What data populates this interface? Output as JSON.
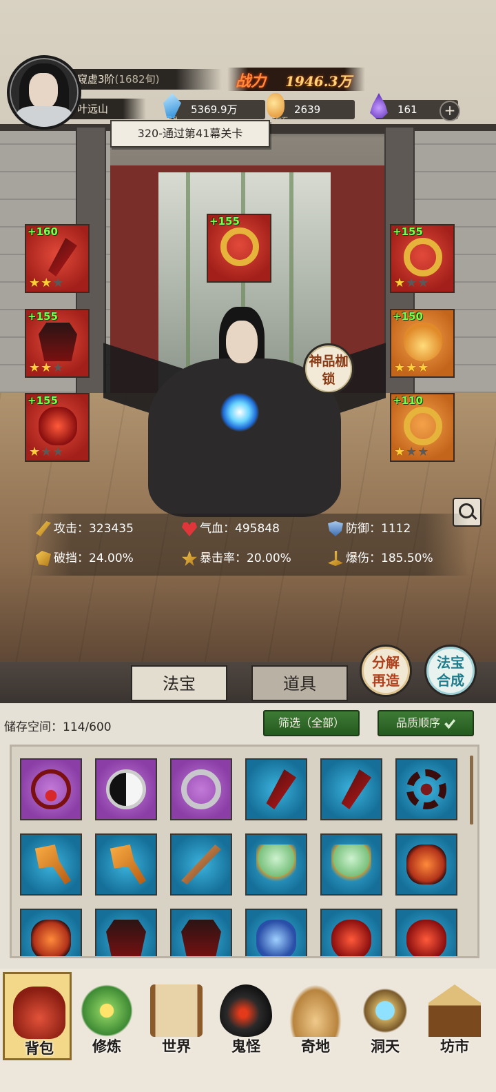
{
  "header": {
    "realm": "窥虚3阶",
    "realm_sub": "(1682旬)",
    "player_name": "叶远山",
    "power_label": "战力",
    "power_value": "1946.3万",
    "resources": [
      {
        "icon": "spirit-crystal-icon",
        "caption": "灵晶",
        "value": "5369.9万"
      },
      {
        "icon": "creation-stone-icon",
        "caption": "造化石",
        "value": "2639"
      },
      {
        "icon": "soul-flame-icon",
        "caption": "",
        "value": "161"
      }
    ],
    "plus_label": "+",
    "quest": "320-通过第41幕关卡"
  },
  "equipment": {
    "slots": [
      {
        "pos": "left-1",
        "level": "+160",
        "quality": "red",
        "stars": 2,
        "icon": "dagger-icon"
      },
      {
        "pos": "left-2",
        "level": "+155",
        "quality": "red",
        "stars": 2,
        "icon": "armor-icon"
      },
      {
        "pos": "left-3",
        "level": "+155",
        "quality": "red",
        "stars": 1,
        "icon": "helmet-icon"
      },
      {
        "pos": "top",
        "level": "+155",
        "quality": "red",
        "stars": 0,
        "icon": "cloud-talisman-icon"
      },
      {
        "pos": "right-1",
        "level": "+155",
        "quality": "red",
        "stars": 1,
        "icon": "crown-icon"
      },
      {
        "pos": "right-2",
        "level": "+150",
        "quality": "orange",
        "stars": 3,
        "icon": "pendant-icon"
      },
      {
        "pos": "right-3",
        "level": "+110",
        "quality": "orange",
        "stars": 1,
        "icon": "ring-icon"
      }
    ],
    "divine_lock": "神品枷锁"
  },
  "stats": [
    {
      "icon": "attack-icon",
      "label": "攻击：",
      "value": "323435"
    },
    {
      "icon": "hp-heart-icon",
      "label": "气血：",
      "value": "495848"
    },
    {
      "icon": "defense-shield-icon",
      "label": "防御：",
      "value": "1112"
    },
    {
      "icon": "break-block-icon",
      "label": "破挡：",
      "value": "24.00%"
    },
    {
      "icon": "crit-rate-icon",
      "label": "暴击率：",
      "value": "20.00%"
    },
    {
      "icon": "crit-damage-icon",
      "label": "爆伤：",
      "value": "185.50%"
    }
  ],
  "tabs": {
    "fabao": "法宝",
    "daoju": "道具",
    "active": "fabao"
  },
  "round_buttons": {
    "decompose": "分解再造",
    "synthesize": "法宝合成"
  },
  "inventory": {
    "storage_label": "储存空间：",
    "storage_value": "114/600",
    "filter_label": "筛选（全部）",
    "sort_label": "品质顺序",
    "items": [
      {
        "quality": "purple",
        "icon": "necklace-icon"
      },
      {
        "quality": "purple",
        "icon": "yin-yang-ring-icon"
      },
      {
        "quality": "purple",
        "icon": "jade-ring-icon"
      },
      {
        "quality": "blue",
        "icon": "dagger-icon"
      },
      {
        "quality": "blue",
        "icon": "dagger-icon"
      },
      {
        "quality": "blue",
        "icon": "wheel-icon"
      },
      {
        "quality": "blue",
        "icon": "axe-icon"
      },
      {
        "quality": "blue",
        "icon": "axe-icon"
      },
      {
        "quality": "blue",
        "icon": "staff-icon"
      },
      {
        "quality": "blue",
        "icon": "jade-mirror-icon"
      },
      {
        "quality": "blue",
        "icon": "jade-mirror-icon"
      },
      {
        "quality": "blue",
        "icon": "golden-beast-icon"
      },
      {
        "quality": "blue",
        "icon": "golden-beast-icon"
      },
      {
        "quality": "blue",
        "icon": "armor-icon"
      },
      {
        "quality": "blue",
        "icon": "armor-icon"
      },
      {
        "quality": "blue",
        "icon": "blue-beast-icon"
      },
      {
        "quality": "blue",
        "icon": "demon-mask-icon"
      },
      {
        "quality": "blue",
        "icon": "demon-mask-icon"
      }
    ]
  },
  "nav": [
    {
      "id": "bag",
      "label": "背包",
      "icon": "bag-icon",
      "active": true
    },
    {
      "id": "cultivate",
      "label": "修炼",
      "icon": "lotus-icon",
      "active": false
    },
    {
      "id": "world",
      "label": "世界",
      "icon": "scroll-map-icon",
      "active": false
    },
    {
      "id": "monster",
      "label": "鬼怪",
      "icon": "demon-egg-icon",
      "active": false
    },
    {
      "id": "wonderland",
      "label": "奇地",
      "icon": "floating-land-icon",
      "active": false
    },
    {
      "id": "cave",
      "label": "洞天",
      "icon": "portal-gate-icon",
      "active": false
    },
    {
      "id": "market",
      "label": "坊市",
      "icon": "market-stall-icon",
      "active": false
    }
  ]
}
